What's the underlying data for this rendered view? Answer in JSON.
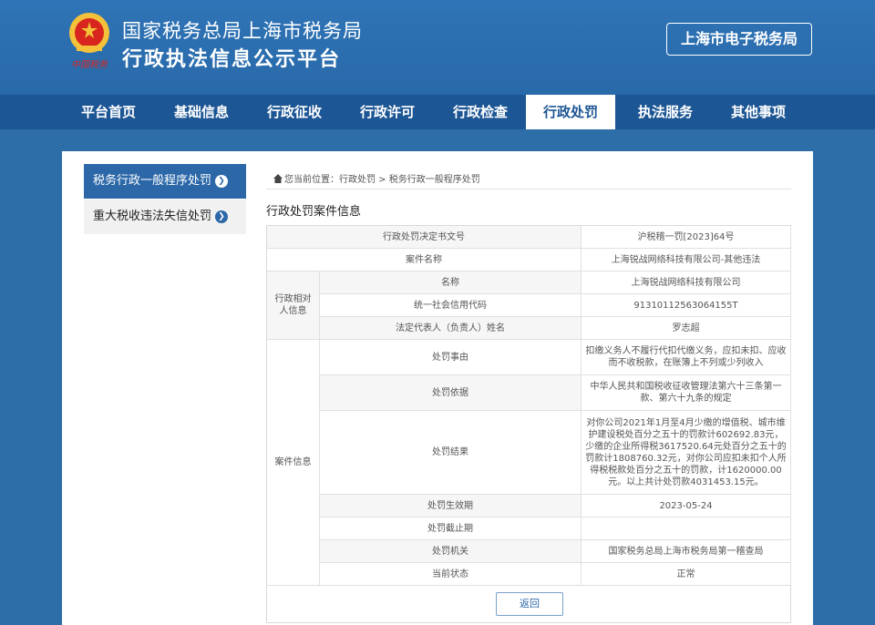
{
  "header": {
    "org_name": "国家税务总局上海市税务局",
    "platform_name": "行政执法信息公示平台",
    "emblem_caption": "中国税务",
    "portal_button": "上海市电子税务局"
  },
  "nav": {
    "items": [
      {
        "label": "平台首页"
      },
      {
        "label": "基础信息"
      },
      {
        "label": "行政征收"
      },
      {
        "label": "行政许可"
      },
      {
        "label": "行政检查"
      },
      {
        "label": "行政处罚",
        "active": true
      },
      {
        "label": "执法服务"
      },
      {
        "label": "其他事项"
      }
    ]
  },
  "sidebar": {
    "items": [
      {
        "label": "税务行政一般程序处罚",
        "active": true
      },
      {
        "label": "重大税收违法失信处罚"
      }
    ]
  },
  "breadcrumb": {
    "prefix": "您当前位置：",
    "path": "行政处罚 > 税务行政一般程序处罚"
  },
  "section_title": "行政处罚案件信息",
  "case": {
    "decision_no_label": "行政处罚决定书文号",
    "decision_no": "沪税稽一罚[2023]64号",
    "case_name_label": "案件名称",
    "case_name": "上海锐战网络科技有限公司-其他违法",
    "party_group_label": "行政相对人信息",
    "party_name_label": "名称",
    "party_name": "上海锐战网络科技有限公司",
    "credit_code_label": "统一社会信用代码",
    "credit_code": "91310112563064155T",
    "legal_rep_label": "法定代表人（负责人）姓名",
    "legal_rep": "罗志超",
    "case_group_label": "案件信息",
    "reason_label": "处罚事由",
    "reason": "扣缴义务人不履行代扣代缴义务，应扣未扣、应收而不收税款，在账簿上不列或少列收入",
    "basis_label": "处罚依据",
    "basis": "中华人民共和国税收征收管理法第六十三条第一款、第六十九条的规定",
    "result_label": "处罚结果",
    "result": "对你公司2021年1月至4月少缴的增值税、城市维护建设税处百分之五十的罚款计602692.83元，少缴的企业所得税3617520.64元处百分之五十的罚款计1808760.32元，对你公司应扣未扣个人所得税税款处百分之五十的罚款，计1620000.00元。以上共计处罚款4031453.15元。",
    "effective_date_label": "处罚生效期",
    "effective_date": "2023-05-24",
    "end_date_label": "处罚截止期",
    "end_date": "",
    "authority_label": "处罚机关",
    "authority": "国家税务总局上海市税务局第一稽查局",
    "status_label": "当前状态",
    "status": "正常"
  },
  "back_button": "返回",
  "colors": {
    "header_blue": "#2f74b6",
    "nav_blue": "#1d5694",
    "accent_blue": "#2c68a8"
  }
}
